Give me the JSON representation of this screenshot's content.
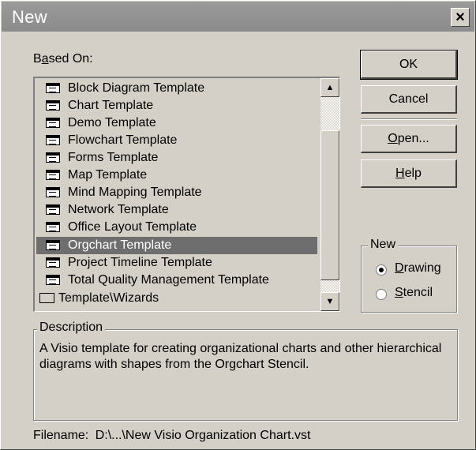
{
  "window": {
    "title": "New",
    "close_symbol": "×"
  },
  "based_on_label_pre": "B",
  "based_on_label_u": "a",
  "based_on_label_post": "sed On:",
  "templates": [
    "Block Diagram Template",
    "Chart Template",
    "Demo Template",
    "Flowchart Template",
    "Forms Template",
    "Map Template",
    "Mind Mapping Template",
    "Network Template",
    "Office Layout Template",
    "Orgchart Template",
    "Project Timeline Template",
    "Total Quality Management Template"
  ],
  "selected_template": "Orgchart Template",
  "folder_item": "Template\\Wizards",
  "buttons": {
    "ok": "OK",
    "cancel": "Cancel",
    "open_u": "O",
    "open_rest": "pen...",
    "help_u": "H",
    "help_rest": "elp"
  },
  "new_group": {
    "title": "New",
    "drawing_u": "D",
    "drawing_rest": "rawing",
    "stencil_u": "S",
    "stencil_rest": "tencil",
    "selected": "Drawing"
  },
  "description": {
    "title": "Description",
    "text": "A Visio template for creating organizational charts and other hierarchical diagrams with shapes from the Orgchart Stencil."
  },
  "filename": {
    "label": "Filename:",
    "value": "D:\\...\\New Visio Organization Chart.vst"
  }
}
